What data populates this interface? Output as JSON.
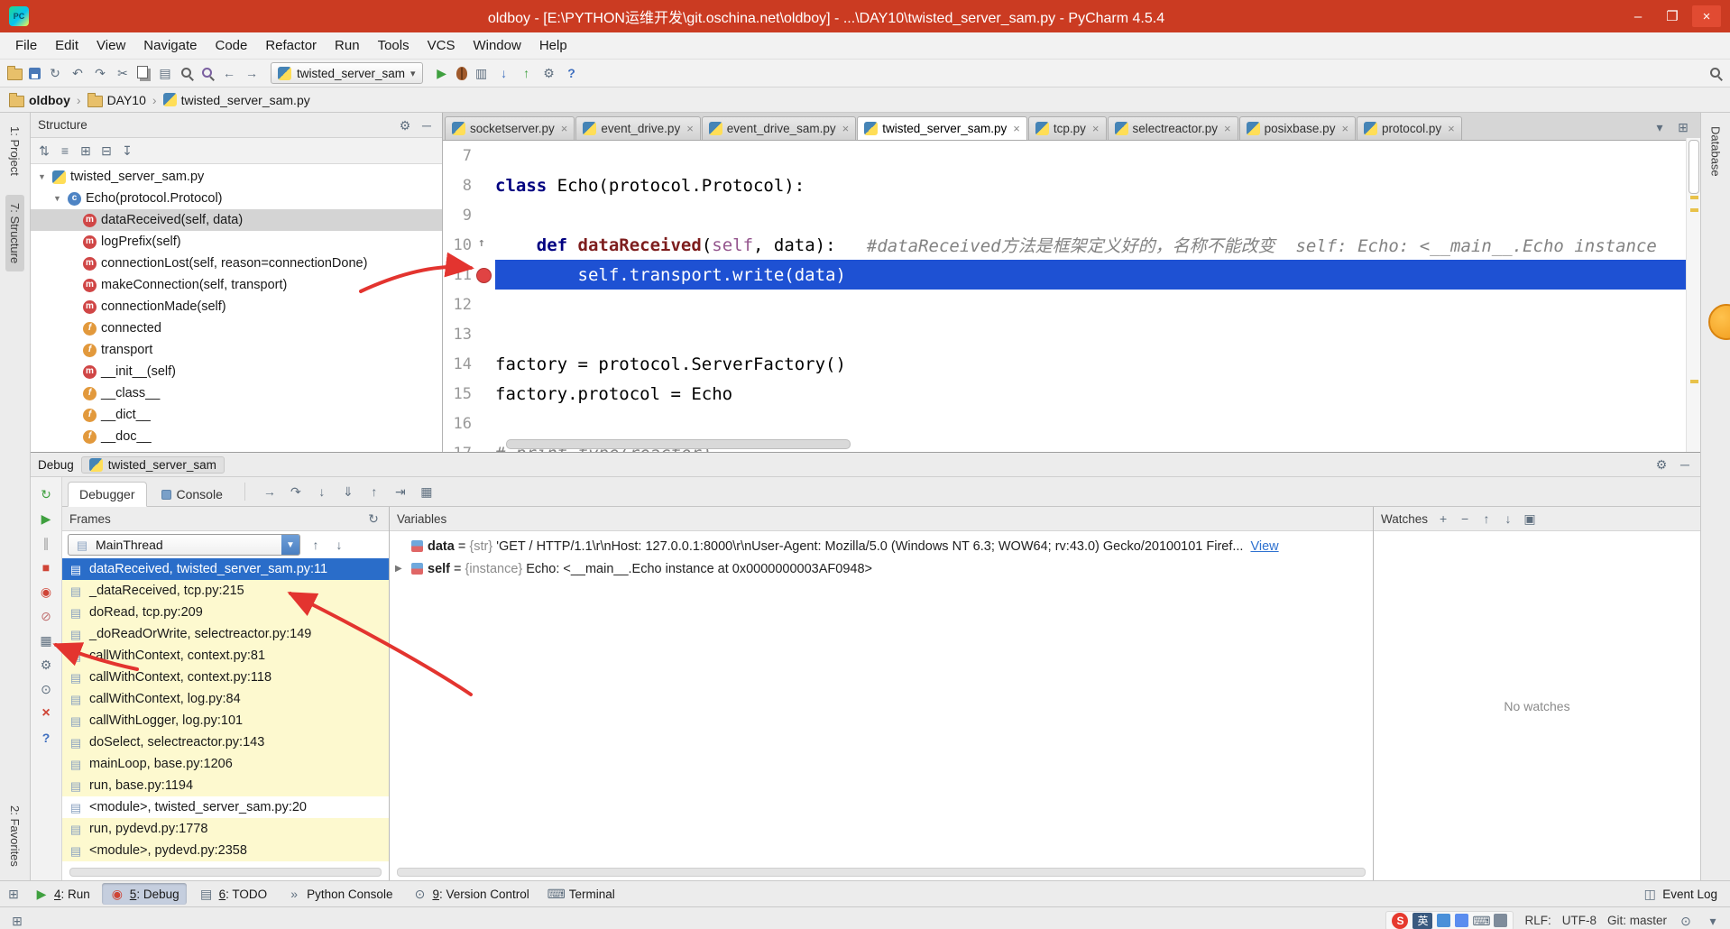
{
  "window": {
    "title": "oldboy - [E:\\PYTHON运维开发\\git.oschina.net\\oldboy] - ...\\DAY10\\twisted_server_sam.py - PyCharm 4.5.4"
  },
  "menu_bar": {
    "items": [
      "File",
      "Edit",
      "View",
      "Navigate",
      "Code",
      "Refactor",
      "Run",
      "Tools",
      "VCS",
      "Window",
      "Help"
    ]
  },
  "toolbar": {
    "run_config": "twisted_server_sam",
    "icons_left": [
      "open-folder",
      "save-all",
      "synchronize",
      "undo",
      "redo",
      "cut",
      "copy",
      "paste",
      "find",
      "replace",
      "back",
      "forward"
    ],
    "icons_right": [
      "run",
      "debug",
      "coverage",
      "vcs-update",
      "vcs-commit",
      "settings",
      "help"
    ]
  },
  "breadcrumbs": [
    {
      "label": "oldboy",
      "icon": "folder"
    },
    {
      "label": "DAY10",
      "icon": "folder"
    },
    {
      "label": "twisted_server_sam.py",
      "icon": "python-file"
    }
  ],
  "tool_strips": {
    "left_top": [
      {
        "label": "1: Project",
        "active": false
      },
      {
        "label": "7: Structure",
        "active": true
      }
    ],
    "left_bottom": [
      {
        "label": "2: Favorites",
        "active": false
      }
    ],
    "right_top": [
      {
        "label": "Database",
        "active": false
      }
    ]
  },
  "structure_panel": {
    "title": "Structure",
    "toolbar_icons": [
      "sort",
      "filter",
      "expand-all",
      "collapse-all",
      "autoscroll"
    ],
    "tree": [
      {
        "label": "twisted_server_sam.py",
        "icon": "python-file",
        "indent": 0,
        "expanded": true
      },
      {
        "label": "Echo(protocol.Protocol)",
        "icon": "class",
        "indent": 1,
        "expanded": true
      },
      {
        "label": "dataReceived(self, data)",
        "icon": "method",
        "indent": 2,
        "selected": true
      },
      {
        "label": "logPrefix(self)",
        "icon": "method",
        "indent": 2
      },
      {
        "label": "connectionLost(self, reason=connectionDone)",
        "icon": "method",
        "indent": 2
      },
      {
        "label": "makeConnection(self, transport)",
        "icon": "method",
        "indent": 2
      },
      {
        "label": "connectionMade(self)",
        "icon": "method",
        "indent": 2
      },
      {
        "label": "connected",
        "icon": "field",
        "indent": 2
      },
      {
        "label": "transport",
        "icon": "field",
        "indent": 2
      },
      {
        "label": "__init__(self)",
        "icon": "method-private",
        "indent": 2
      },
      {
        "label": "__class__",
        "icon": "field-class",
        "indent": 2
      },
      {
        "label": "__dict__",
        "icon": "field",
        "indent": 2
      },
      {
        "label": "__doc__",
        "icon": "field",
        "indent": 2
      }
    ]
  },
  "editor": {
    "tabs": [
      {
        "label": "socketserver.py",
        "active": false
      },
      {
        "label": "event_drive.py",
        "active": false
      },
      {
        "label": "event_drive_sam.py",
        "active": false
      },
      {
        "label": "twisted_server_sam.py",
        "active": true
      },
      {
        "label": "tcp.py",
        "active": false
      },
      {
        "label": "selectreactor.py",
        "active": false
      },
      {
        "label": "posixbase.py",
        "active": false
      },
      {
        "label": "protocol.py",
        "active": false
      }
    ],
    "lines": [
      {
        "num": "7",
        "segments": []
      },
      {
        "num": "8",
        "segments": [
          {
            "text": "class ",
            "style": "kw"
          },
          {
            "text": "Echo(protocol.Protocol):",
            "style": "plain"
          }
        ]
      },
      {
        "num": "9",
        "segments": []
      },
      {
        "num": "10",
        "gutter": "override",
        "segments": [
          {
            "text": "    ",
            "style": "plain"
          },
          {
            "text": "def ",
            "style": "kw"
          },
          {
            "text": "dataReceived",
            "style": "fn"
          },
          {
            "text": "(",
            "style": "plain"
          },
          {
            "text": "self",
            "style": "self"
          },
          {
            "text": ", data):   ",
            "style": "plain"
          },
          {
            "text": "#dataReceived方法是框架定义好的，名称不能改变  self: Echo: <__main__.Echo instance",
            "style": "comment"
          }
        ]
      },
      {
        "num": "11",
        "current": true,
        "breakpoint": true,
        "segments": [
          {
            "text": "        self.transport.write(data)",
            "style": "exec"
          }
        ]
      },
      {
        "num": "12",
        "segments": []
      },
      {
        "num": "13",
        "segments": []
      },
      {
        "num": "14",
        "segments": [
          {
            "text": "factory = protocol.ServerFactory()",
            "style": "plain"
          }
        ]
      },
      {
        "num": "15",
        "segments": [
          {
            "text": "factory.protocol = Echo",
            "style": "plain"
          }
        ]
      },
      {
        "num": "16",
        "segments": []
      },
      {
        "num": "17",
        "segments": [
          {
            "text": "# print type(reactor)",
            "style": "comment"
          }
        ]
      }
    ]
  },
  "debug_panel": {
    "title": "Debug",
    "session": "twisted_server_sam",
    "tabs": [
      {
        "label": "Debugger",
        "active": true,
        "indicator": false
      },
      {
        "label": "Console",
        "active": false,
        "indicator": true
      }
    ],
    "step_icons": [
      "execution-point",
      "step-over",
      "step-into",
      "force-step-into",
      "step-out",
      "run-to-cursor",
      "evaluate"
    ],
    "left_toolbar": [
      "rerun",
      "resume",
      "pause",
      "stop",
      "view-breakpoints",
      "mute-breakpoints",
      "restore-layout",
      "settings",
      "pin",
      "close",
      "help-debug"
    ],
    "frames": {
      "title": "Frames",
      "thread": "MainThread",
      "items": [
        {
          "label": "dataReceived, twisted_server_sam.py:11",
          "state": "selected"
        },
        {
          "label": "_dataReceived, tcp.py:215",
          "state": "library"
        },
        {
          "label": "doRead, tcp.py:209",
          "state": "library"
        },
        {
          "label": "_doReadOrWrite, selectreactor.py:149",
          "state": "library"
        },
        {
          "label": "callWithContext, context.py:81",
          "state": "library"
        },
        {
          "label": "callWithContext, context.py:118",
          "state": "library"
        },
        {
          "label": "callWithContext, log.py:84",
          "state": "library"
        },
        {
          "label": "callWithLogger, log.py:101",
          "state": "library"
        },
        {
          "label": "doSelect, selectreactor.py:143",
          "state": "library"
        },
        {
          "label": "mainLoop, base.py:1206",
          "state": "library"
        },
        {
          "label": "run, base.py:1194",
          "state": "library"
        },
        {
          "label": "<module>, twisted_server_sam.py:20",
          "state": "project"
        },
        {
          "label": "run, pydevd.py:1778",
          "state": "library"
        },
        {
          "label": "<module>, pydevd.py:2358",
          "state": "library"
        }
      ]
    },
    "variables": {
      "title": "Variables",
      "items": [
        {
          "name": "data",
          "type": "{str}",
          "value": "'GET / HTTP/1.1\\r\\nHost: 127.0.0.1:8000\\r\\nUser-Agent: Mozilla/5.0 (Windows NT 6.3; WOW64; rv:43.0) Gecko/20100101 Firef...",
          "link": "View",
          "expandable": false
        },
        {
          "name": "self",
          "type": "{instance}",
          "value": "Echo: <__main__.Echo instance at 0x0000000003AF0948>",
          "link": "",
          "expandable": true
        }
      ]
    },
    "watches": {
      "title": "Watches",
      "toolbar": [
        "add",
        "remove",
        "move-up",
        "move-down",
        "copy-watch"
      ],
      "empty_text": "No watches"
    }
  },
  "bottom_bar": {
    "items": [
      {
        "label": "4: Run",
        "icon": "run-small",
        "active": false
      },
      {
        "label": "5: Debug",
        "icon": "debug-small",
        "active": true
      },
      {
        "label": "6: TODO",
        "icon": "todo-small",
        "active": false
      },
      {
        "label": "Python Console",
        "icon": "console-small",
        "active": false
      },
      {
        "label": "9: Version Control",
        "icon": "vcs-small",
        "active": false
      },
      {
        "label": "Terminal",
        "icon": "terminal-small",
        "active": false
      }
    ],
    "right_items": [
      {
        "label": "Event Log",
        "icon": "eventlog-small",
        "active": false
      }
    ]
  },
  "status_bar": {
    "ime": [
      "S",
      "英"
    ],
    "line_ending": "RLF:",
    "encoding": "UTF-8",
    "vcs": "Git: master"
  }
}
